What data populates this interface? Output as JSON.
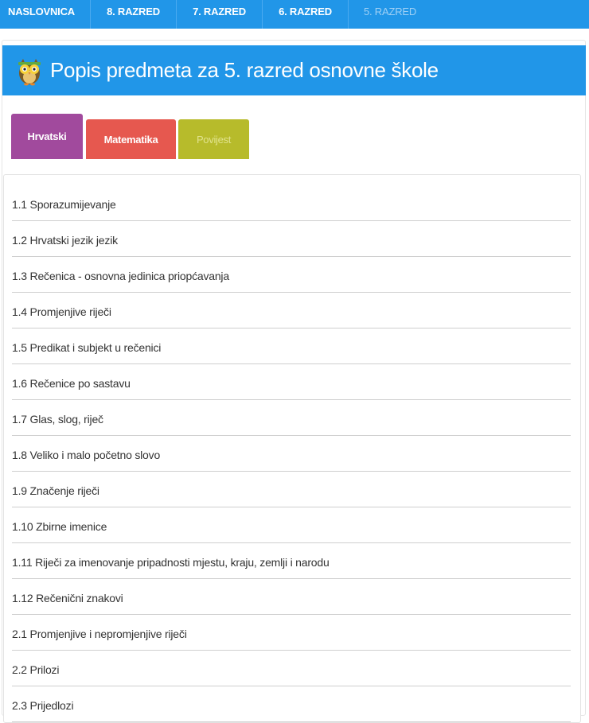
{
  "nav": {
    "items": [
      {
        "label": "NASLOVNICA"
      },
      {
        "label": "8. RAZRED"
      },
      {
        "label": "7. RAZRED"
      },
      {
        "label": "6. RAZRED"
      },
      {
        "label": "5. RAZRED",
        "active": true
      }
    ]
  },
  "header": {
    "icon": "owl-icon",
    "title": "Popis predmeta za 5. razred osnovne škole"
  },
  "tabs": [
    {
      "label": "Hrvatski",
      "color": "#a14a9d",
      "active": true
    },
    {
      "label": "Matematika",
      "color": "#e6584f"
    },
    {
      "label": "Povijest",
      "color": "#b7bb2b"
    }
  ],
  "topics": [
    "1.1 Sporazumijevanje",
    "1.2 Hrvatski jezik jezik",
    "1.3 Rečenica - osnovna jedinica priopćavanja",
    "1.4 Promjenjive riječi",
    "1.5 Predikat i subjekt u rečenici",
    "1.6 Rečenice po sastavu",
    "1.7 Glas, slog, riječ",
    "1.8 Veliko i malo početno slovo",
    "1.9 Značenje riječi",
    "1.10 Zbirne imenice",
    "1.11 Riječi za imenovanje pripadnosti mjestu, kraju, zemlji i narodu",
    "1.12 Rečenični znakovi",
    "2.1 Promjenjive i nepromjenjive riječi",
    "2.2 Prilozi",
    "2.3 Prijedlozi"
  ],
  "colors": {
    "brand_blue": "#2196e8"
  }
}
